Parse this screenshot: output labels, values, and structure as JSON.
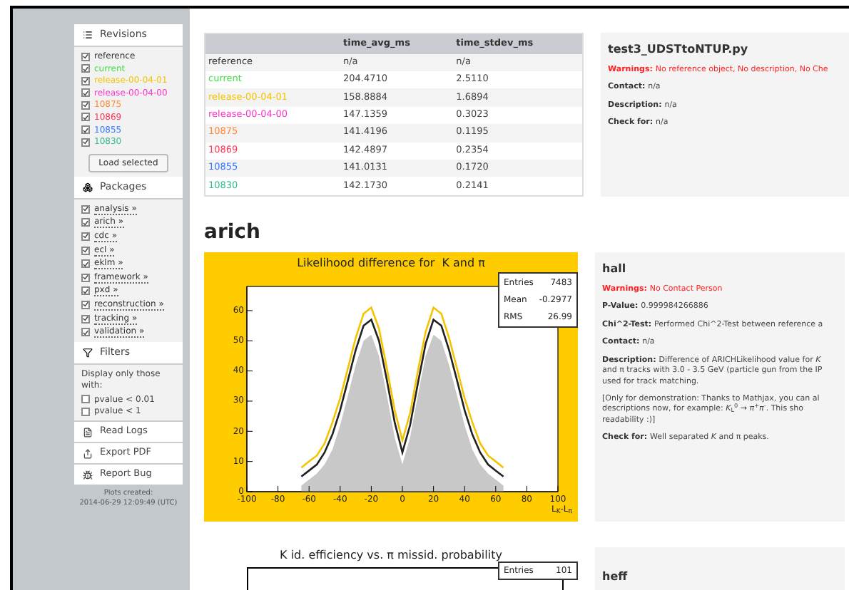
{
  "sidebar": {
    "revisions": {
      "title": "Revisions",
      "items": [
        {
          "label": "reference",
          "checked": true,
          "color": "#333333"
        },
        {
          "label": "current",
          "checked": true,
          "color": "#44dd44"
        },
        {
          "label": "release-00-04-01",
          "checked": true,
          "color": "#f5c400"
        },
        {
          "label": "release-00-04-00",
          "checked": true,
          "color": "#ff33cc"
        },
        {
          "label": "10875",
          "checked": true,
          "color": "#ff8833"
        },
        {
          "label": "10869",
          "checked": true,
          "color": "#ff3355"
        },
        {
          "label": "10855",
          "checked": true,
          "color": "#3377ff"
        },
        {
          "label": "10830",
          "checked": true,
          "color": "#33bb88"
        }
      ],
      "button": "Load selected"
    },
    "packages": {
      "title": "Packages",
      "items": [
        {
          "label": "analysis »",
          "checked": true
        },
        {
          "label": "arich »",
          "checked": true
        },
        {
          "label": "cdc »",
          "checked": true
        },
        {
          "label": "ecl »",
          "checked": true
        },
        {
          "label": "eklm »",
          "checked": true
        },
        {
          "label": "framework »",
          "checked": true
        },
        {
          "label": "pxd »",
          "checked": true
        },
        {
          "label": "reconstruction »",
          "checked": true
        },
        {
          "label": "tracking »",
          "checked": true
        },
        {
          "label": "validation »",
          "checked": true
        }
      ]
    },
    "filters": {
      "title": "Filters",
      "text": "Display only those with:",
      "items": [
        {
          "label": "pvalue < 0.01",
          "checked": false
        },
        {
          "label": "pvalue < 1",
          "checked": false
        }
      ]
    },
    "actions": [
      {
        "kind": "logs",
        "label": "Read Logs"
      },
      {
        "kind": "export",
        "label": "Export PDF"
      },
      {
        "kind": "bug",
        "label": "Report Bug"
      }
    ],
    "footer": [
      "Plots created:",
      "2014-06-29 12:09:49 (UTC)"
    ]
  },
  "table": {
    "columns": [
      "time_avg_ms",
      "time_stdev_ms"
    ],
    "rows": [
      {
        "name": "reference",
        "color": "#333333",
        "values": [
          "n/a",
          "n/a"
        ]
      },
      {
        "name": "current",
        "color": "#44dd44",
        "values": [
          "204.4710",
          "2.5110"
        ]
      },
      {
        "name": "release-00-04-01",
        "color": "#f5c400",
        "values": [
          "158.8884",
          "1.6894"
        ]
      },
      {
        "name": "release-00-04-00",
        "color": "#ff33cc",
        "values": [
          "147.1359",
          "0.3023"
        ]
      },
      {
        "name": "10875",
        "color": "#ff8833",
        "values": [
          "141.4196",
          "0.1195"
        ]
      },
      {
        "name": "10869",
        "color": "#ff3355",
        "values": [
          "142.4897",
          "0.2354"
        ]
      },
      {
        "name": "10855",
        "color": "#3377ff",
        "values": [
          "141.0131",
          "0.1720"
        ]
      },
      {
        "name": "10830",
        "color": "#33bb88",
        "values": [
          "142.1730",
          "0.2141"
        ]
      }
    ]
  },
  "test_card": {
    "title": "test3_UDSTtoNTUP.py",
    "fields": [
      {
        "kind": "warning",
        "label": "Warnings:",
        "text": "No reference object, No description, No Che"
      },
      {
        "kind": "plain",
        "label": "Contact:",
        "text": "n/a"
      },
      {
        "kind": "plain",
        "label": "Description:",
        "text": "n/a"
      },
      {
        "kind": "plain",
        "label": "Check for:",
        "text": "n/a"
      }
    ]
  },
  "package_title": "arich",
  "plot": {
    "stats": [
      {
        "label": "Entries",
        "value": "7483"
      },
      {
        "label": "Mean",
        "value": "-0.2977"
      },
      {
        "label": "RMS",
        "value": "26.99"
      }
    ],
    "chart_data": {
      "type": "line",
      "title": "Likelihood difference for  K and π",
      "xlabel": "L$_{K}$-L$_{π}$",
      "xlim": [
        -100,
        100
      ],
      "ylim": [
        0,
        68
      ],
      "xticks": [
        -100,
        -80,
        -60,
        -40,
        -20,
        0,
        20,
        40,
        60,
        80,
        100
      ],
      "yticks": [
        0,
        10,
        20,
        30,
        40,
        50,
        60
      ],
      "x": [
        -65,
        -60,
        -55,
        -50,
        -45,
        -40,
        -35,
        -30,
        -25,
        -20,
        -15,
        -10,
        -5,
        0,
        5,
        10,
        15,
        20,
        25,
        30,
        35,
        40,
        45,
        50,
        55,
        60,
        65
      ],
      "series": [
        {
          "type": "area",
          "color": "#c8c8c8",
          "values": [
            2,
            4,
            6,
            9,
            14,
            22,
            32,
            42,
            50,
            52,
            45,
            32,
            18,
            9,
            18,
            32,
            45,
            52,
            50,
            42,
            32,
            22,
            14,
            9,
            6,
            4,
            2
          ]
        },
        {
          "type": "line",
          "color": "#222222",
          "values": [
            5,
            7,
            9,
            13,
            19,
            27,
            37,
            47,
            55,
            57,
            50,
            37,
            23,
            13,
            22,
            36,
            49,
            57,
            55,
            47,
            37,
            27,
            19,
            13,
            9,
            7,
            5
          ]
        },
        {
          "type": "line",
          "color": "#f5c400",
          "values": [
            8,
            10,
            12,
            16,
            23,
            31,
            41,
            51,
            59,
            61,
            54,
            41,
            27,
            17,
            26,
            40,
            53,
            61,
            59,
            51,
            41,
            31,
            23,
            16,
            12,
            10,
            8
          ]
        }
      ]
    }
  },
  "hall_card": {
    "title": "hall",
    "fields": [
      {
        "kind": "warning",
        "label": "Warnings:",
        "text": "No Contact Person"
      },
      {
        "kind": "plain",
        "label": "P-Value:",
        "text": "0.999984266886"
      },
      {
        "kind": "plain",
        "label": "Chi^2-Test:",
        "text": "Performed Chi^2-Test between reference a"
      },
      {
        "kind": "plain",
        "label": "Contact:",
        "text": "n/a"
      },
      {
        "kind": "plain",
        "label": "Description:",
        "text": "Difference of ARICHLikelihood value for *K* and π tracks with 3.0 - 3.5 GeV (particle gun from the IP used for track matching."
      },
      {
        "kind": "note",
        "text": "[Only for demonstration: Thanks to Mathjax, you can al descriptions now, for example: *K*$_{L}$$^{0}$ → *π*$^{+}$*π*$^{-}$. This sho readability :)]"
      },
      {
        "kind": "plain",
        "label": "Check for:",
        "text": "Well separated *K* and π peaks."
      }
    ]
  },
  "plot2": {
    "title": "K id. efficiency vs. π missid. probability",
    "stats": [
      {
        "label": "Entries",
        "value": "101"
      }
    ]
  },
  "card2_title": "heff"
}
